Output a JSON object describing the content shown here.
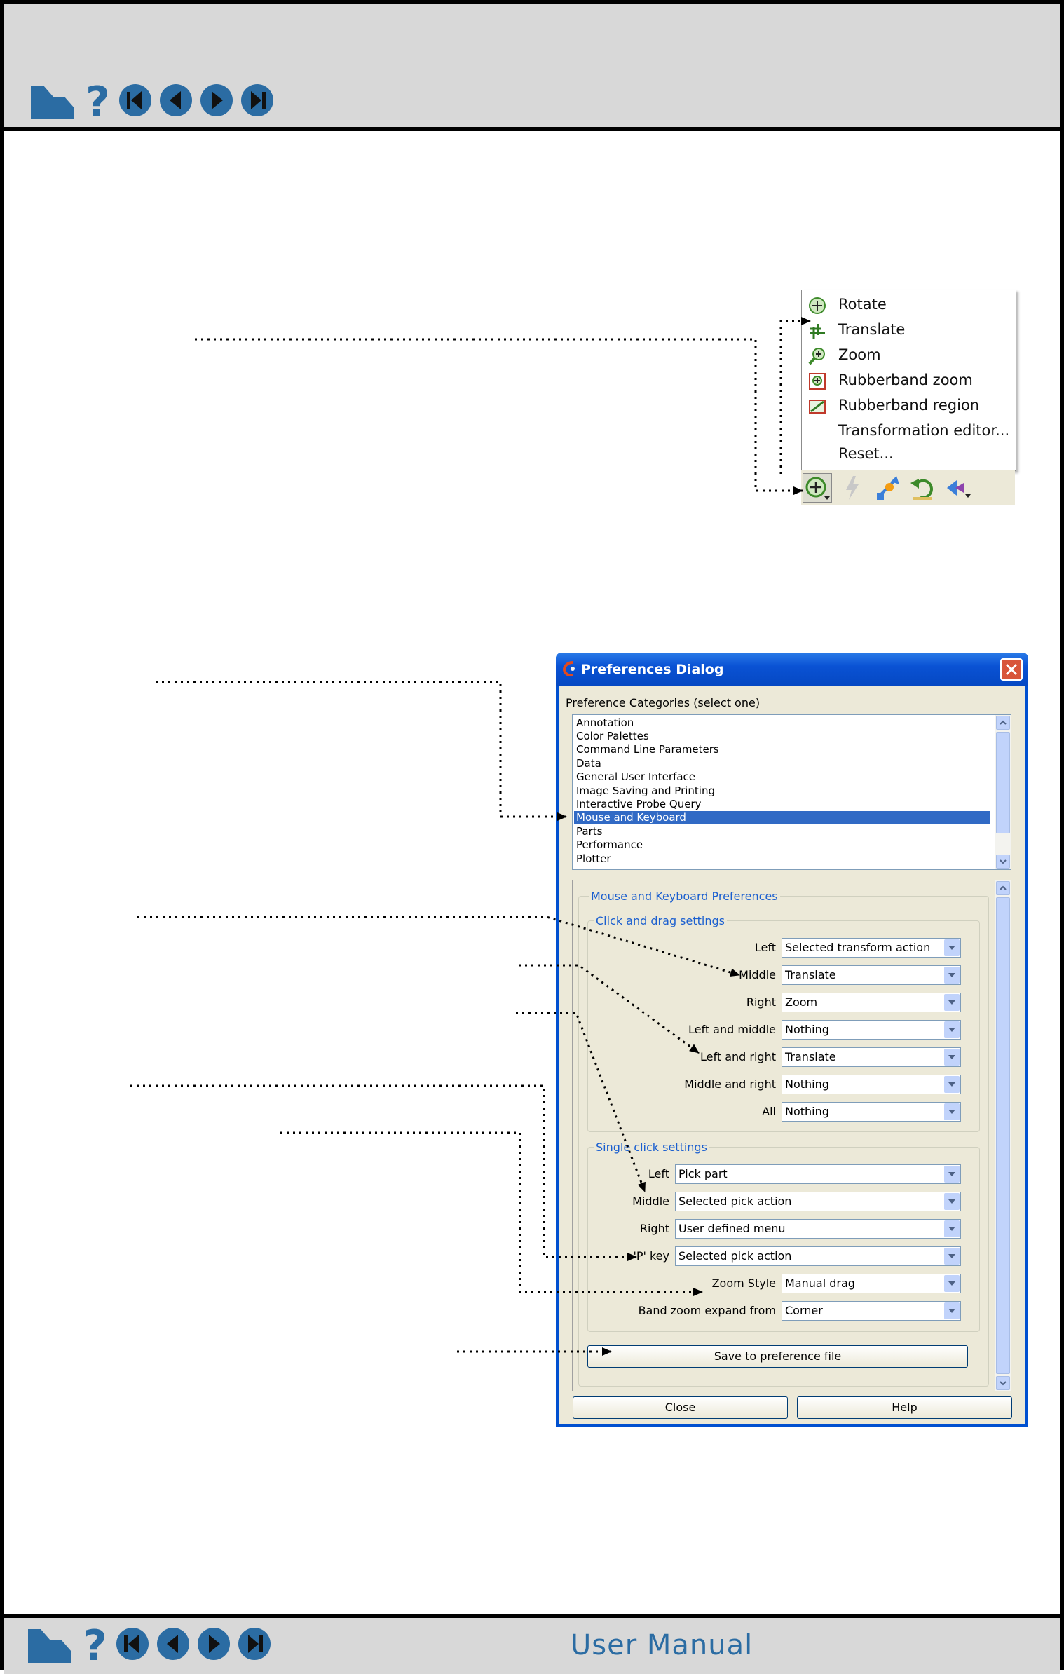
{
  "footer": {
    "title": "User Manual"
  },
  "popup_menu": {
    "items": [
      {
        "label": "Rotate",
        "icon": "rotate-icon"
      },
      {
        "label": "Translate",
        "icon": "translate-icon"
      },
      {
        "label": "Zoom",
        "icon": "zoom-icon"
      },
      {
        "label": "Rubberband zoom",
        "icon": "rubberband-zoom-icon"
      },
      {
        "label": "Rubberband region",
        "icon": "rubberband-region-icon"
      },
      {
        "label": "Transformation editor...",
        "icon": ""
      },
      {
        "label": "Reset...",
        "icon": ""
      }
    ]
  },
  "dialog": {
    "title": "Preferences Dialog",
    "categories_label": "Preference Categories (select one)",
    "categories": [
      "Annotation",
      "Color Palettes",
      "Command Line Parameters",
      "Data",
      "General User Interface",
      "Image Saving and Printing",
      "Interactive Probe Query",
      "Mouse and Keyboard",
      "Parts",
      "Performance",
      "Plotter"
    ],
    "selected_category": "Mouse and Keyboard",
    "panel_title": "Mouse and Keyboard Preferences",
    "click_drag": {
      "title": "Click and drag settings",
      "rows": [
        {
          "label": "Left",
          "value": "Selected transform action"
        },
        {
          "label": "Middle",
          "value": "Translate"
        },
        {
          "label": "Right",
          "value": "Zoom"
        },
        {
          "label": "Left and middle",
          "value": "Nothing"
        },
        {
          "label": "Left and right",
          "value": "Translate"
        },
        {
          "label": "Middle and right",
          "value": "Nothing"
        },
        {
          "label": "All",
          "value": "Nothing"
        }
      ]
    },
    "single_click": {
      "title": "Single click settings",
      "rows": [
        {
          "label": "Left",
          "value": "Pick part"
        },
        {
          "label": "Middle",
          "value": "Selected pick action"
        },
        {
          "label": "Right",
          "value": "User defined menu"
        },
        {
          "label": "'P' key",
          "value": "Selected pick action"
        }
      ],
      "zoom_rows": [
        {
          "label": "Zoom Style",
          "value": "Manual drag"
        },
        {
          "label": "Band zoom expand from",
          "value": "Corner"
        }
      ]
    },
    "save_button": "Save to preference file",
    "close_button": "Close",
    "help_button": "Help"
  }
}
